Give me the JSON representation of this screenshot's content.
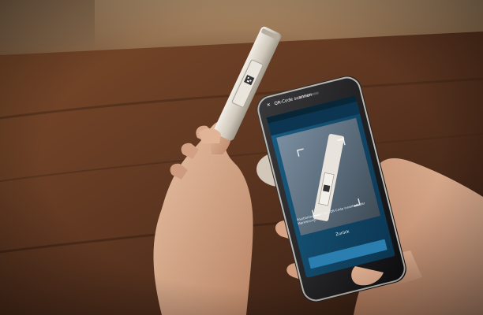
{
  "phone_screen": {
    "header_title": "QR-Code scannen",
    "instruction_text": "Positionieren Sie den QR-Code innerhalb der Markierung.",
    "button_label": "Zurück"
  },
  "colors": {
    "screen_bg": "#0f4a6a",
    "screen_header": "#0b3550",
    "button_bg": "#2a7fb0",
    "table_wood": "#5a3420"
  }
}
